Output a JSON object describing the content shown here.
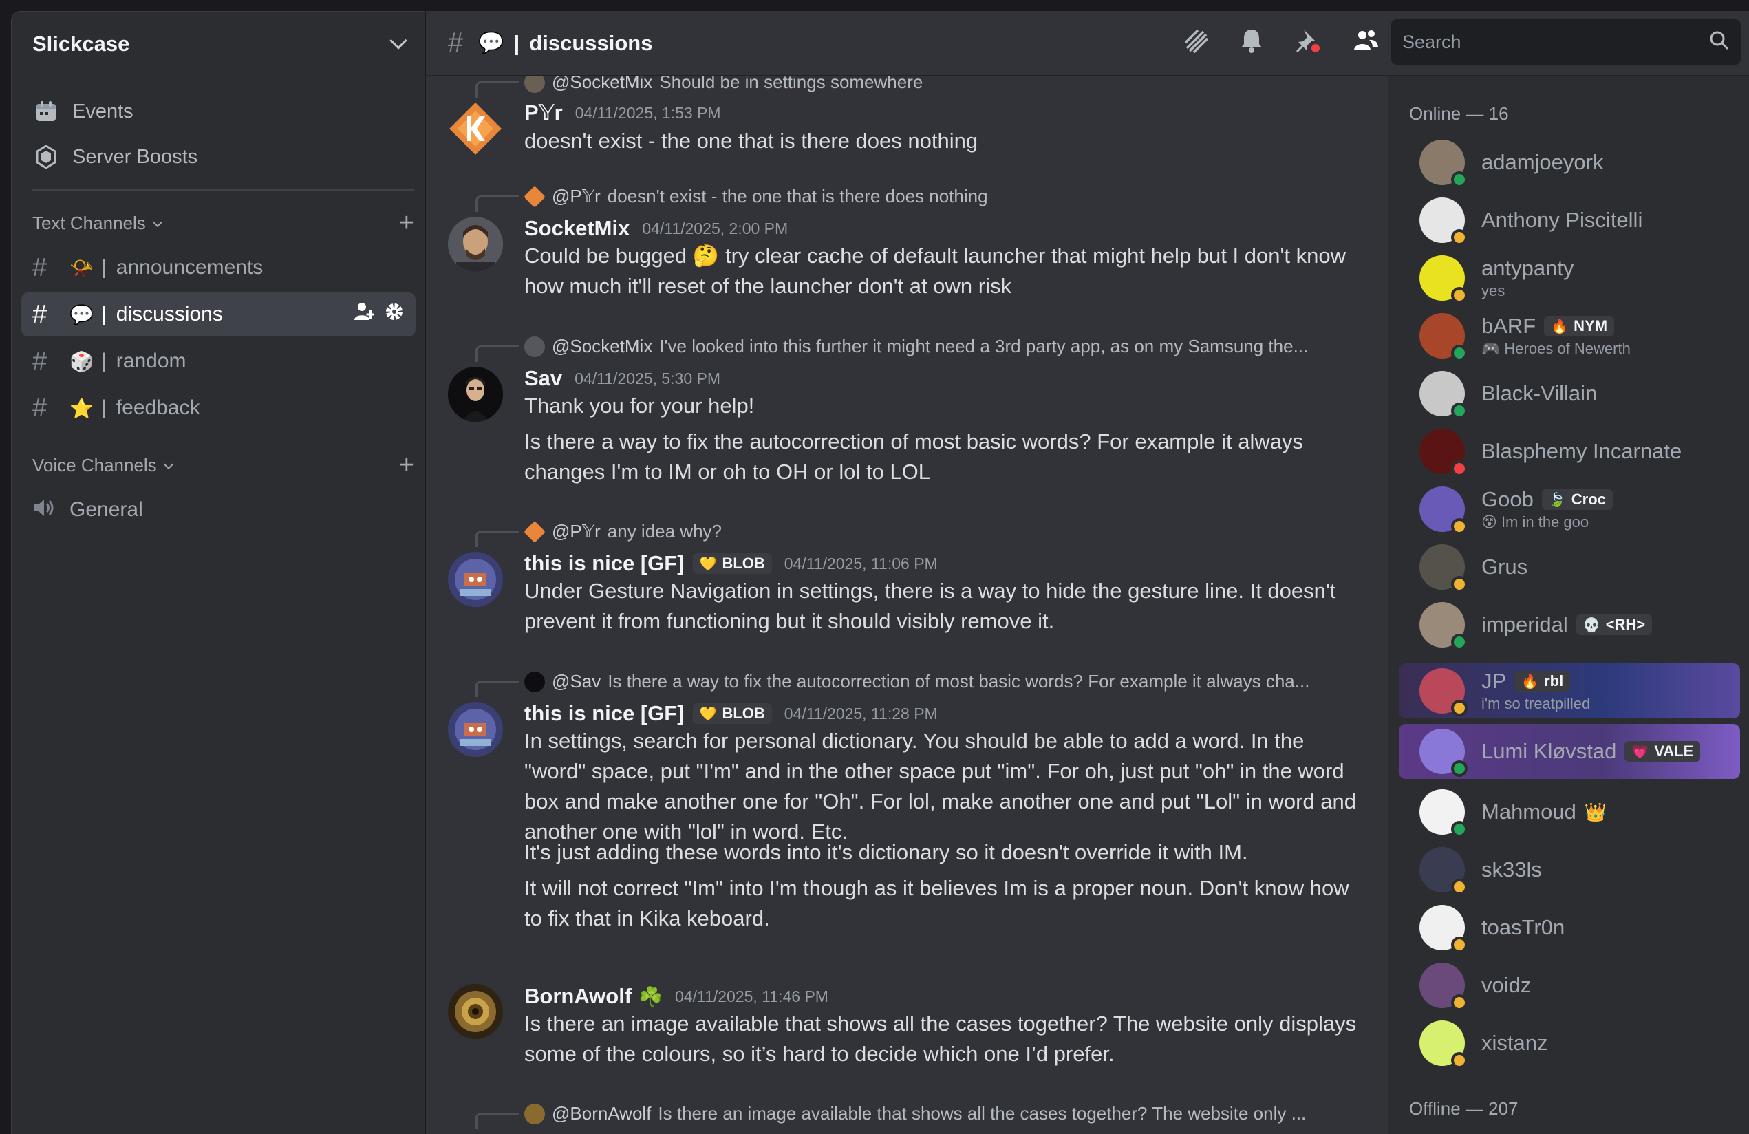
{
  "server": {
    "name": "Slickcase"
  },
  "sidebar": {
    "nav": [
      {
        "label": "Events",
        "icon": "calendar-icon"
      },
      {
        "label": "Server Boosts",
        "icon": "boost-gem-icon"
      }
    ],
    "text_category": "Text Channels",
    "voice_category": "Voice Channels",
    "channels": [
      {
        "emoji": "📯",
        "sep": "|",
        "name": "announcements"
      },
      {
        "emoji": "💬",
        "sep": "|",
        "name": "discussions"
      },
      {
        "emoji": "🎲",
        "sep": "|",
        "name": "random"
      },
      {
        "emoji": "⭐",
        "sep": "|",
        "name": "feedback"
      }
    ],
    "voice": [
      {
        "name": "General"
      }
    ]
  },
  "topbar": {
    "emoji": "💬",
    "sep": "|",
    "channel": "discussions",
    "search_placeholder": "Search"
  },
  "messages": [
    {
      "reply": {
        "name": "@SocketMix",
        "text": "Should be in settings somewhere"
      },
      "author": "P𝕐r",
      "timestamp": "04/11/2025, 1:53 PM",
      "lines": [
        "doesn't exist - the one that is there does nothing"
      ]
    },
    {
      "reply": {
        "name": "@P𝕐r",
        "text": "doesn't exist - the one that is there does nothing"
      },
      "author": "SocketMix",
      "timestamp": "04/11/2025, 2:00 PM",
      "lines": [
        "Could be bugged 🤔 try clear cache of default launcher that might help but I don't know how much it'll reset of the launcher don't at own risk"
      ]
    },
    {
      "reply": {
        "name": "@SocketMix",
        "text": "I've looked into this further it might need a 3rd party app, as on my Samsung the..."
      },
      "author": "Sav",
      "timestamp": "04/11/2025, 5:30 PM",
      "lines": [
        "Thank you for your help!",
        "Is there a way to fix the autocorrection of most basic words? For example it always changes I'm to IM or oh to OH or lol to LOL"
      ]
    },
    {
      "reply": {
        "name": "@P𝕐r",
        "text": "any idea why?"
      },
      "author": "this is nice [GF]",
      "tag": "BLOB",
      "timestamp": "04/11/2025, 11:06 PM",
      "lines": [
        "Under Gesture Navigation in settings, there is a way to hide the gesture line. It doesn't prevent it from functioning but it should visibly remove it."
      ]
    },
    {
      "reply": {
        "name": "@Sav",
        "text": "Is there a way to fix the autocorrection of most basic words? For example it always cha..."
      },
      "author": "this is nice [GF]",
      "tag": "BLOB",
      "timestamp": "04/11/2025, 11:28 PM",
      "lines": [
        "In settings, search for personal dictionary. You should be able to add a word. In the \"word\" space, put \"I'm\" and in the other space put \"im\". For oh, just put \"oh\" in the word box and make another one for \"Oh\". For lol, make another one and put \"Lol\" in word and another one with \"lol\" in word. Etc.",
        "It's just adding these words into it's dictionary so it doesn't override it with IM.",
        "It will not correct \"Im\" into I'm though as it believes Im is a proper noun. Don't know how to fix that in Kika keboard."
      ]
    },
    {
      "author": "BornAwolf",
      "author_emoji": "☘️",
      "timestamp": "04/11/2025, 11:46 PM",
      "lines": [
        "Is there an image available that shows all the cases together? The website only displays some of the colours, so it’s hard to decide which one I’d prefer."
      ]
    },
    {
      "reply": {
        "name": "@BornAwolf",
        "text": "Is there an image available that shows all the cases together? The website only ..."
      }
    }
  ],
  "members": {
    "online_header": "Online — 16",
    "offline_header": "Offline — 207",
    "list": [
      {
        "name": "adamjoeyork",
        "status": "online"
      },
      {
        "name": "Anthony Piscitelli",
        "status": "idle"
      },
      {
        "name": "antypanty",
        "status": "idle",
        "sub": "yes"
      },
      {
        "name": "bARF",
        "status": "online",
        "tag": "NYM",
        "sub": "Heroes of Newerth"
      },
      {
        "name": "Black-Villain",
        "status": "online"
      },
      {
        "name": "Blasphemy Incarnate",
        "status": "dnd"
      },
      {
        "name": "Goob",
        "status": "idle",
        "tag": "Croc",
        "sub": "Im in the goo"
      },
      {
        "name": "Grus",
        "status": "idle"
      },
      {
        "name": "imperidal",
        "status": "online",
        "tag": "<RH>"
      },
      {
        "name": "JP",
        "status": "idle",
        "tag": "rbl",
        "sub": "i'm so treatpilled"
      },
      {
        "name": "Lumi Kløvstad",
        "status": "online",
        "tag": "VALE"
      },
      {
        "name": "Mahmoud",
        "status": "online",
        "badge": "👑"
      },
      {
        "name": "sk33ls",
        "status": "idle"
      },
      {
        "name": "toasTr0n",
        "status": "idle"
      },
      {
        "name": "voidz",
        "status": "idle"
      },
      {
        "name": "xistanz",
        "status": "idle"
      }
    ]
  }
}
